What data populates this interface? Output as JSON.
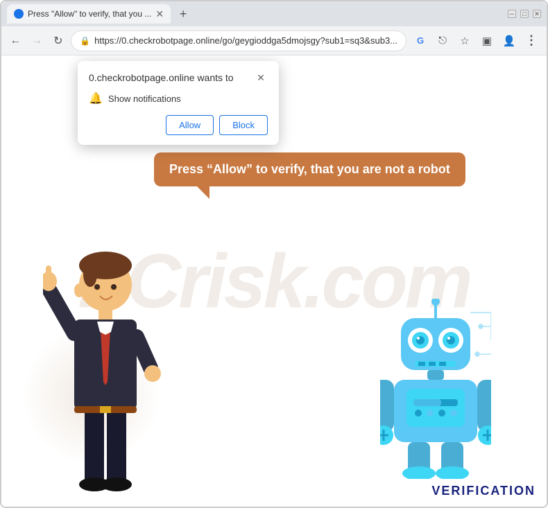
{
  "browser": {
    "tab": {
      "title": "Press \"Allow\" to verify, that you ...",
      "favicon": "shield"
    },
    "address": {
      "url": "https://0.checkrobotpage.online/go/geygioddga5dmojsgy?sub1=sq3&sub3...",
      "lock_icon": "🔒"
    },
    "controls": {
      "back": "←",
      "forward": "→",
      "refresh": "↻",
      "minimize": "─",
      "maximize": "□",
      "close": "✕",
      "new_tab": "+",
      "tab_close": "✕"
    }
  },
  "popup": {
    "title": "0.checkrobotpage.online wants to",
    "close_label": "✕",
    "notification_label": "Show notifications",
    "allow_label": "Allow",
    "block_label": "Block"
  },
  "page": {
    "speech_bubble": "Press “Allow” to verify, that you are not a robot",
    "watermark": "PCrisk.com",
    "verification_label": "VERIFICATION"
  },
  "toolbar": {
    "google_icon": "G",
    "share_icon": "⎋",
    "star_icon": "☆",
    "ext_icon": "▣",
    "profile_icon": "👤",
    "menu_icon": "⋮"
  }
}
